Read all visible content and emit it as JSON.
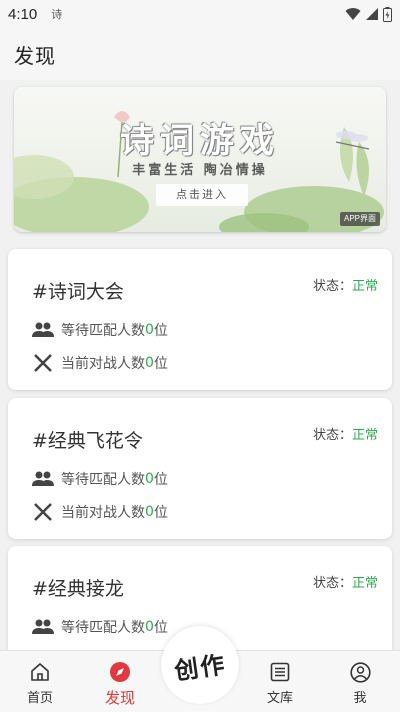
{
  "status_bar": {
    "time": "4:10",
    "app_icon_text": "诗"
  },
  "header": {
    "title": "发现"
  },
  "banner": {
    "title": "诗词游戏",
    "subtitle": "丰富生活 陶冶情操",
    "enter_label": "点击进入",
    "corner_tag": "APP界面"
  },
  "cards": [
    {
      "title": "#诗词大会",
      "status_label": "状态：",
      "status_value": "正常",
      "waiting_prefix": "等待匹配人数",
      "waiting_count": "0",
      "waiting_suffix": "位",
      "battle_prefix": "当前对战人数",
      "battle_count": "0",
      "battle_suffix": "位"
    },
    {
      "title": "#经典飞花令",
      "status_label": "状态：",
      "status_value": "正常",
      "waiting_prefix": "等待匹配人数",
      "waiting_count": "0",
      "waiting_suffix": "位",
      "battle_prefix": "当前对战人数",
      "battle_count": "0",
      "battle_suffix": "位"
    },
    {
      "title": "#经典接龙",
      "status_label": "状态：",
      "status_value": "正常",
      "waiting_prefix": "等待匹配人数",
      "waiting_count": "0",
      "waiting_suffix": "位"
    }
  ],
  "nav": {
    "home": "首页",
    "discover": "发现",
    "create": "创作",
    "library": "文库",
    "me": "我"
  },
  "colors": {
    "accent_red": "#e0393e",
    "status_green": "#2fa84f"
  },
  "icons": {
    "waiting": "people-icon",
    "battle": "crossed-swords-icon"
  }
}
